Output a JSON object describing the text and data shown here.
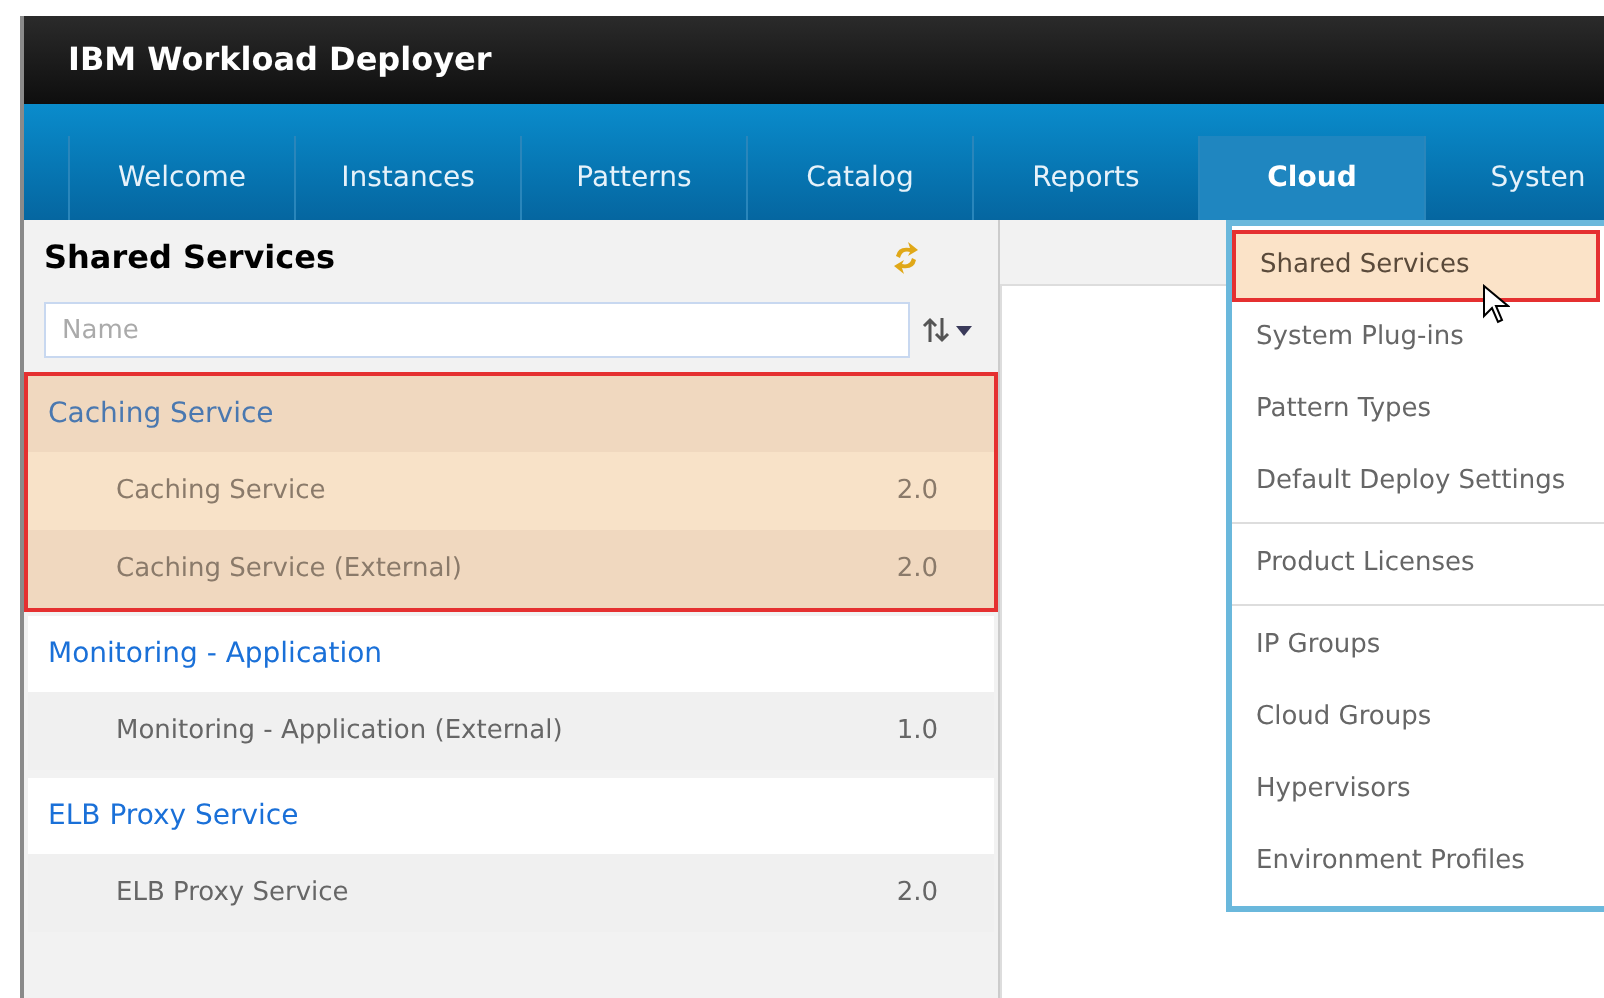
{
  "header": {
    "title": "IBM Workload Deployer"
  },
  "nav_tabs": [
    {
      "label": "Welcome",
      "selected": false
    },
    {
      "label": "Instances",
      "selected": false
    },
    {
      "label": "Patterns",
      "selected": false
    },
    {
      "label": "Catalog",
      "selected": false
    },
    {
      "label": "Reports",
      "selected": false
    },
    {
      "label": "Cloud",
      "selected": true
    },
    {
      "label": "Systen",
      "selected": false
    }
  ],
  "panel": {
    "title": "Shared Services",
    "search": {
      "placeholder": "Name"
    }
  },
  "groups": [
    {
      "name": "Caching Service",
      "highlighted": true,
      "children": [
        {
          "name": "Caching Service",
          "version": "2.0"
        },
        {
          "name": "Caching Service (External)",
          "version": "2.0"
        }
      ]
    },
    {
      "name": "Monitoring - Application",
      "highlighted": false,
      "children": [
        {
          "name": "Monitoring - Application (External)",
          "version": "1.0"
        }
      ]
    },
    {
      "name": "ELB Proxy Service",
      "highlighted": false,
      "children": [
        {
          "name": "ELB Proxy Service",
          "version": "2.0"
        }
      ]
    }
  ],
  "menu": {
    "sections": [
      [
        {
          "label": "Shared Services",
          "selected": true
        },
        {
          "label": "System Plug-ins",
          "selected": false
        },
        {
          "label": "Pattern Types",
          "selected": false
        },
        {
          "label": "Default Deploy Settings",
          "selected": false
        }
      ],
      [
        {
          "label": "Product Licenses",
          "selected": false
        }
      ],
      [
        {
          "label": "IP Groups",
          "selected": false
        },
        {
          "label": "Cloud Groups",
          "selected": false
        },
        {
          "label": "Hypervisors",
          "selected": false
        },
        {
          "label": "Environment Profiles",
          "selected": false
        }
      ]
    ]
  }
}
